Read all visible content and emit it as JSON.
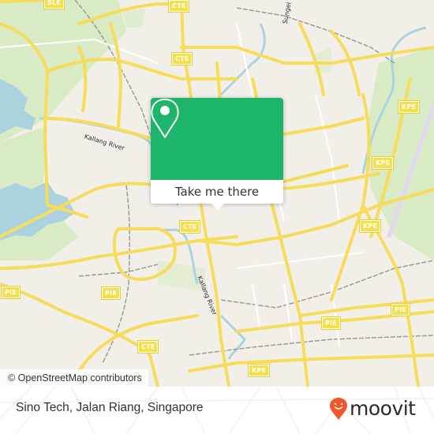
{
  "map": {
    "highway_shields": [
      {
        "label": "SLE"
      },
      {
        "label": "CTE"
      },
      {
        "label": "CTE"
      },
      {
        "label": "KPE"
      },
      {
        "label": "KPE"
      },
      {
        "label": "KPE"
      },
      {
        "label": "CTE"
      },
      {
        "label": "PIE"
      },
      {
        "label": "PIE"
      },
      {
        "label": "PIE"
      },
      {
        "label": "PIE"
      },
      {
        "label": "CTE"
      },
      {
        "label": "KPE"
      }
    ],
    "labels": {
      "kallang_river_north": "Kallang River",
      "kallang_river_south": "Kallang River",
      "sungei": "Sungei"
    },
    "attribution": "© OpenStreetMap contributors"
  },
  "popup": {
    "icon": "location-pin-icon",
    "button_label": "Take me there",
    "color": "#1db56a"
  },
  "footer": {
    "place_name": "Sino Tech, Jalan Riang, Singapore",
    "brand": {
      "name": "moovit",
      "icon": "moovit-pin-logo-icon",
      "color": "#f0582c"
    }
  }
}
